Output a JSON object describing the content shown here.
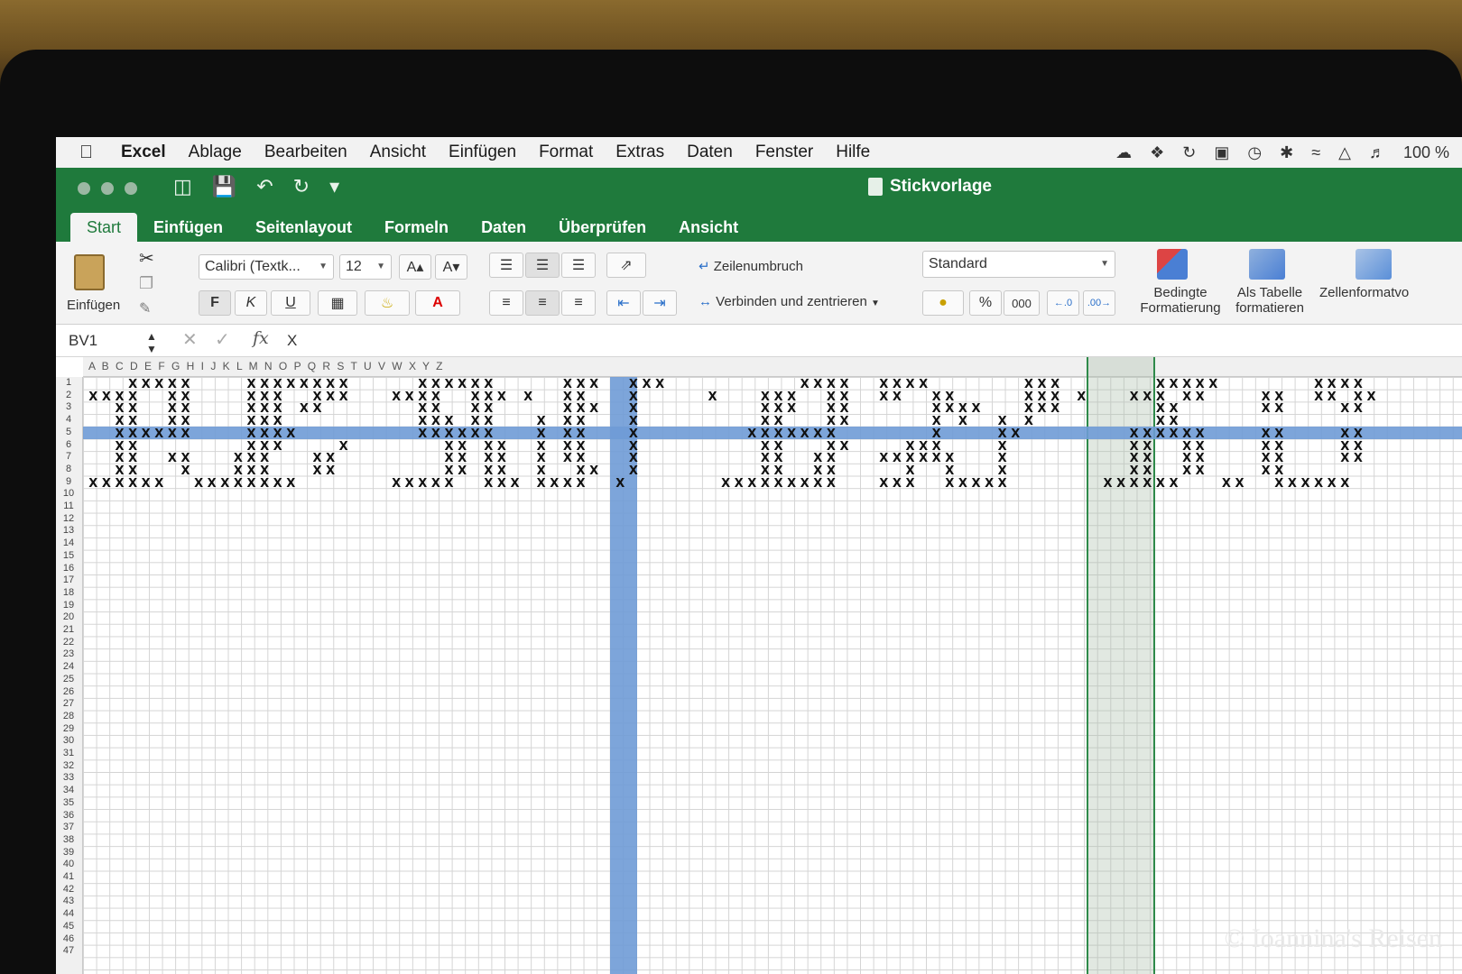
{
  "menubar": {
    "app_name": "Excel",
    "items": [
      "Ablage",
      "Bearbeiten",
      "Ansicht",
      "Einfügen",
      "Format",
      "Extras",
      "Daten",
      "Fenster",
      "Hilfe"
    ],
    "battery": "100 %"
  },
  "window": {
    "title": "Stickvorlage"
  },
  "tabs": [
    "Start",
    "Einfügen",
    "Seitenlayout",
    "Formeln",
    "Daten",
    "Überprüfen",
    "Ansicht"
  ],
  "ribbon": {
    "paste_label": "Einfügen",
    "font_name": "Calibri (Textk...",
    "font_size": "12",
    "bold": "F",
    "italic": "K",
    "underline": "U",
    "wrap_text": "Zeilenumbruch",
    "merge_center": "Verbinden und zentrieren",
    "number_format": "Standard",
    "percent": "%",
    "thousands": "000",
    "cond_format_1": "Bedingte",
    "cond_format_2": "Formatierung",
    "as_table_1": "Als Tabelle",
    "as_table_2": "formatieren",
    "cell_styles": "Zellenformatvo"
  },
  "formula_bar": {
    "name_box": "BV1",
    "fx": "fx",
    "value": "X"
  },
  "sheet": {
    "column_headers": "A B C D E F G H I J K L M N O P Q R S T U V W X Y Z",
    "highlight_color": "#6f9bd6",
    "selection_color": "#2e8a4a",
    "row_count_visible": 47,
    "mark_text": "X"
  },
  "watermark": "© Ioannina's Reisen"
}
